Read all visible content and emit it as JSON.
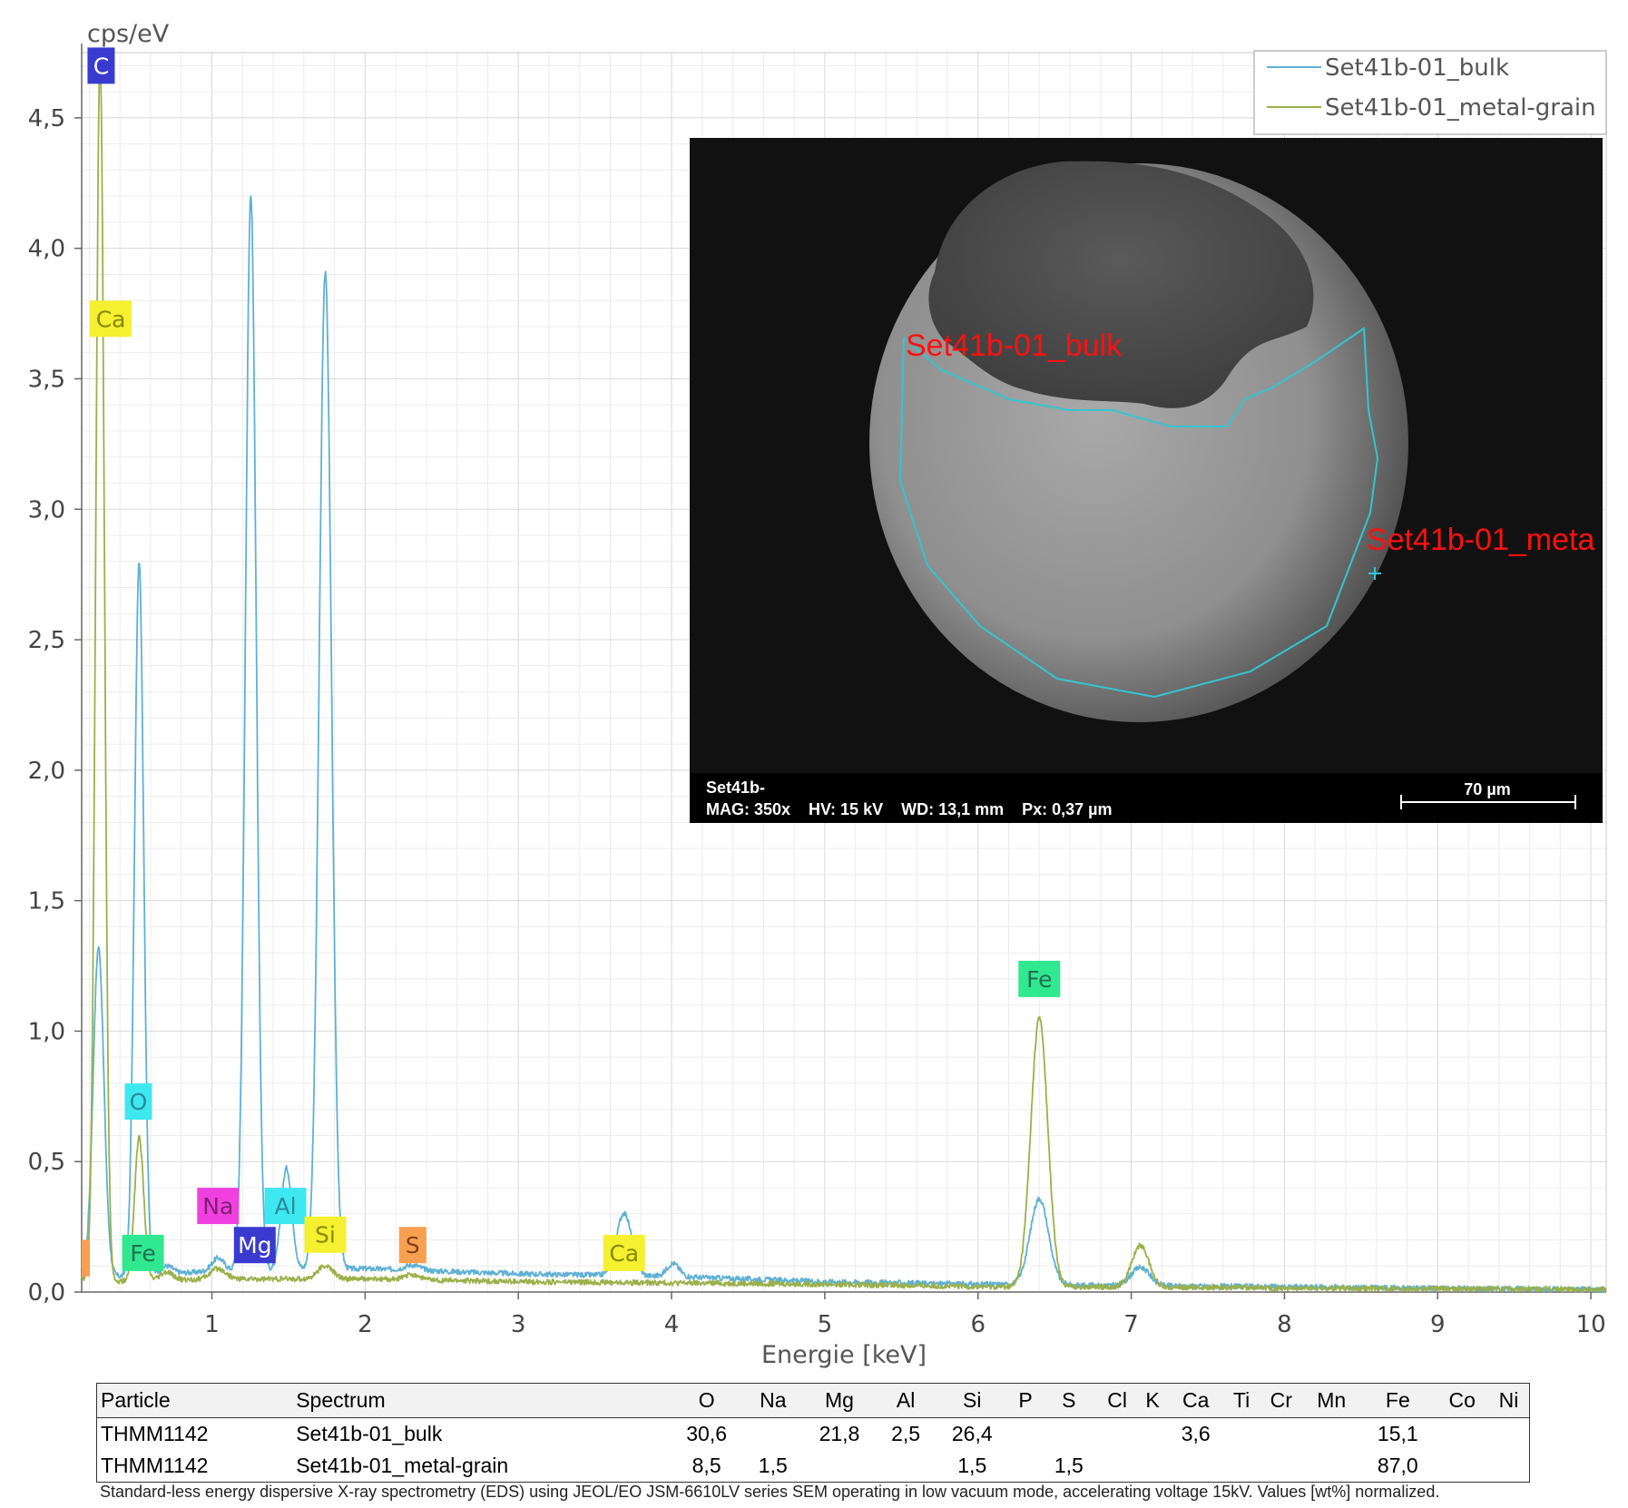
{
  "chart_data": {
    "type": "line",
    "ylabel": "cps/eV",
    "xlabel": "Energie [keV]",
    "xlim": [
      0.15,
      10.1
    ],
    "ylim": [
      0,
      4.75
    ],
    "x_ticks": [
      1,
      2,
      3,
      4,
      5,
      6,
      7,
      8,
      9,
      10
    ],
    "x_tick_labels": [
      "1",
      "2",
      "3",
      "4",
      "5",
      "6",
      "7",
      "8",
      "9",
      "10"
    ],
    "y_ticks": [
      0,
      0.5,
      1.0,
      1.5,
      2.0,
      2.5,
      3.0,
      3.5,
      4.0,
      4.5
    ],
    "y_tick_labels": [
      "0,0",
      "0,5",
      "1,0",
      "1,5",
      "2,0",
      "2,5",
      "3,0",
      "3,5",
      "4,0",
      "4,5"
    ],
    "grid": true,
    "legend_position": "top-right",
    "series": [
      {
        "name": "Set41b-01_bulk",
        "color": "#5fb0d4",
        "baseline": [
          [
            0.15,
            0.08
          ],
          [
            0.4,
            0.06
          ],
          [
            1.0,
            0.08
          ],
          [
            2.0,
            0.09
          ],
          [
            3.0,
            0.07
          ],
          [
            4.0,
            0.06
          ],
          [
            5.0,
            0.04
          ],
          [
            6.0,
            0.03
          ],
          [
            7.0,
            0.025
          ],
          [
            8.0,
            0.02
          ],
          [
            10.1,
            0.01
          ]
        ],
        "peaks": [
          {
            "x": 0.26,
            "height": 1.25,
            "width": 0.035
          },
          {
            "x": 0.525,
            "height": 2.73,
            "width": 0.03
          },
          {
            "x": 0.705,
            "height": 0.03,
            "width": 0.04
          },
          {
            "x": 1.04,
            "height": 0.05,
            "width": 0.04
          },
          {
            "x": 1.254,
            "height": 4.12,
            "width": 0.035
          },
          {
            "x": 1.487,
            "height": 0.39,
            "width": 0.035
          },
          {
            "x": 1.74,
            "height": 3.82,
            "width": 0.04
          },
          {
            "x": 2.31,
            "height": 0.02,
            "width": 0.05
          },
          {
            "x": 3.69,
            "height": 0.24,
            "width": 0.05
          },
          {
            "x": 4.01,
            "height": 0.05,
            "width": 0.04
          },
          {
            "x": 6.4,
            "height": 0.33,
            "width": 0.06
          },
          {
            "x": 7.06,
            "height": 0.07,
            "width": 0.06
          }
        ]
      },
      {
        "name": "Set41b-01_metal-grain",
        "color": "#9bb04a",
        "baseline": [
          [
            0.15,
            0.05
          ],
          [
            0.4,
            0.04
          ],
          [
            1.0,
            0.05
          ],
          [
            2.0,
            0.05
          ],
          [
            3.0,
            0.04
          ],
          [
            4.0,
            0.035
          ],
          [
            5.0,
            0.03
          ],
          [
            6.0,
            0.02
          ],
          [
            7.0,
            0.02
          ],
          [
            8.0,
            0.015
          ],
          [
            10.1,
            0.01
          ]
        ],
        "peaks": [
          {
            "x": 0.27,
            "height": 4.7,
            "width": 0.028
          },
          {
            "x": 0.525,
            "height": 0.55,
            "width": 0.03
          },
          {
            "x": 0.705,
            "height": 0.03,
            "width": 0.04
          },
          {
            "x": 1.04,
            "height": 0.04,
            "width": 0.05
          },
          {
            "x": 1.74,
            "height": 0.05,
            "width": 0.05
          },
          {
            "x": 2.31,
            "height": 0.02,
            "width": 0.05
          },
          {
            "x": 6.4,
            "height": 1.03,
            "width": 0.055
          },
          {
            "x": 7.06,
            "height": 0.16,
            "width": 0.055
          }
        ]
      }
    ],
    "element_labels": [
      {
        "text": "C",
        "x": 0.277,
        "y": 4.7,
        "color": "#3a3ad0",
        "text_color": "#ffffff"
      },
      {
        "text": "Ca",
        "x": 0.34,
        "y": 3.73,
        "color": "#f5f030",
        "text_color": "#888800"
      },
      {
        "text": "O",
        "x": 0.52,
        "y": 0.73,
        "color": "#3ee8f0",
        "text_color": "#2a8a9a"
      },
      {
        "text": "Na",
        "x": 1.04,
        "y": 0.33,
        "color": "#f040e0",
        "text_color": "#802070"
      },
      {
        "text": "Al",
        "x": 1.48,
        "y": 0.33,
        "color": "#3ee8f0",
        "text_color": "#2a8a9a"
      },
      {
        "text": "Fe",
        "x": 0.55,
        "y": 0.15,
        "color": "#30e890",
        "text_color": "#207050"
      },
      {
        "text": "Mg",
        "x": 1.28,
        "y": 0.18,
        "color": "#3a3ad0",
        "text_color": "#ffffff"
      },
      {
        "text": "Si",
        "x": 1.74,
        "y": 0.22,
        "color": "#f5f030",
        "text_color": "#888800"
      },
      {
        "text": "S",
        "x": 2.31,
        "y": 0.18,
        "color": "#f8a050",
        "text_color": "#804020"
      },
      {
        "text": "Ca",
        "x": 3.69,
        "y": 0.15,
        "color": "#f5f030",
        "text_color": "#888800"
      },
      {
        "text": "Fe",
        "x": 6.4,
        "y": 1.2,
        "color": "#30e890",
        "text_color": "#207050"
      }
    ]
  },
  "sem_image": {
    "annotation_bulk": "Set41b-01_bulk",
    "annotation_metal": "Set41b-01_meta",
    "info_line1": "Set41b-",
    "info_line2": "MAG: 350x    HV: 15 kV    WD: 13,1 mm    Px: 0,37 µm",
    "scale_bar_label": "70 µm",
    "annotation_color": "#ff1010",
    "outline_color": "#33c6cf"
  },
  "table": {
    "headers": [
      "Particle",
      "Spectrum",
      "O",
      "Na",
      "Mg",
      "Al",
      "Si",
      "P",
      "S",
      "Cl",
      "K",
      "Ca",
      "Ti",
      "Cr",
      "Mn",
      "Fe",
      "Co",
      "Ni"
    ],
    "rows": [
      [
        "THMM1142",
        "Set41b-01_bulk",
        "30,6",
        "",
        "21,8",
        "2,5",
        "26,4",
        "",
        "",
        "",
        "",
        "3,6",
        "",
        "",
        "",
        "15,1",
        "",
        ""
      ],
      [
        "THMM1142",
        "Set41b-01_metal-grain",
        "8,5",
        "1,5",
        "",
        "",
        "1,5",
        "",
        "1,5",
        "",
        "",
        "",
        "",
        "",
        "",
        "87,0",
        "",
        ""
      ]
    ]
  },
  "caption": "Standard-less energy dispersive X-ray spectrometry (EDS) using JEOL/EO JSM-6610LV series SEM operating in low vacuum mode, accelerating voltage 15kV. Values [wt%] normalized."
}
